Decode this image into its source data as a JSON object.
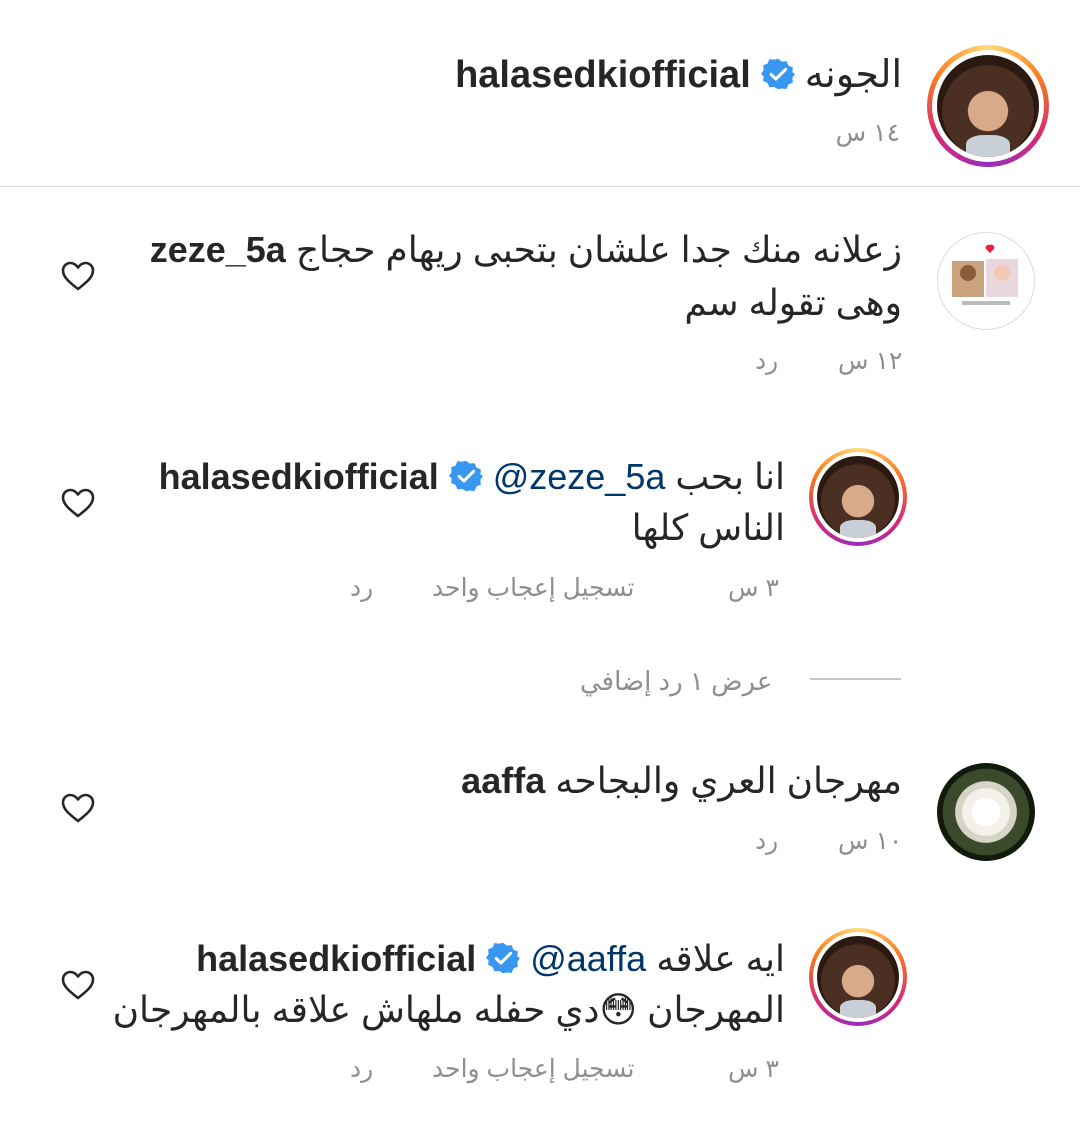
{
  "caption": {
    "username": "halasedkiofficial",
    "text": "الجونه",
    "time": "١٤ س"
  },
  "comments": [
    {
      "username": "zeze_5a",
      "text_line1": "زعلانه منك جدا علشان بتحبى ريهام حجاج",
      "text_line2": "وهى تقوله سم",
      "time": "١٢ س",
      "reply_label": "رد"
    },
    {
      "username": "halasedkiofficial",
      "mention": "@zeze_5a",
      "text_line1_rest": "انا بحب",
      "text_line2": "الناس كلها",
      "time": "٣ س",
      "like_label": "تسجيل إعجاب واحد",
      "reply_label": "رد"
    },
    {
      "view_replies": "عرض ١ رد إضافي"
    },
    {
      "username": "aaffa",
      "text_line1": "مهرجان العري والبجاحه",
      "time": "١٠ س",
      "reply_label": "رد"
    },
    {
      "username": "halasedkiofficial",
      "mention": "@aaffa",
      "text_line1_rest": "ايه علاقه",
      "text_line2_a": "المهرجان",
      "emoji": "😳",
      "text_line2_b": "دي حفله ملهاش علاقه بالمهرجان",
      "time": "٣ س",
      "like_label": "تسجيل إعجاب واحد",
      "reply_label": "رد"
    }
  ],
  "icons": {
    "verified": "verified-badge-icon",
    "heart": "heart-outline-icon"
  },
  "colors": {
    "verified_blue": "#3897f0",
    "mention_blue": "#00376b",
    "meta_gray": "#8e8e8e"
  }
}
